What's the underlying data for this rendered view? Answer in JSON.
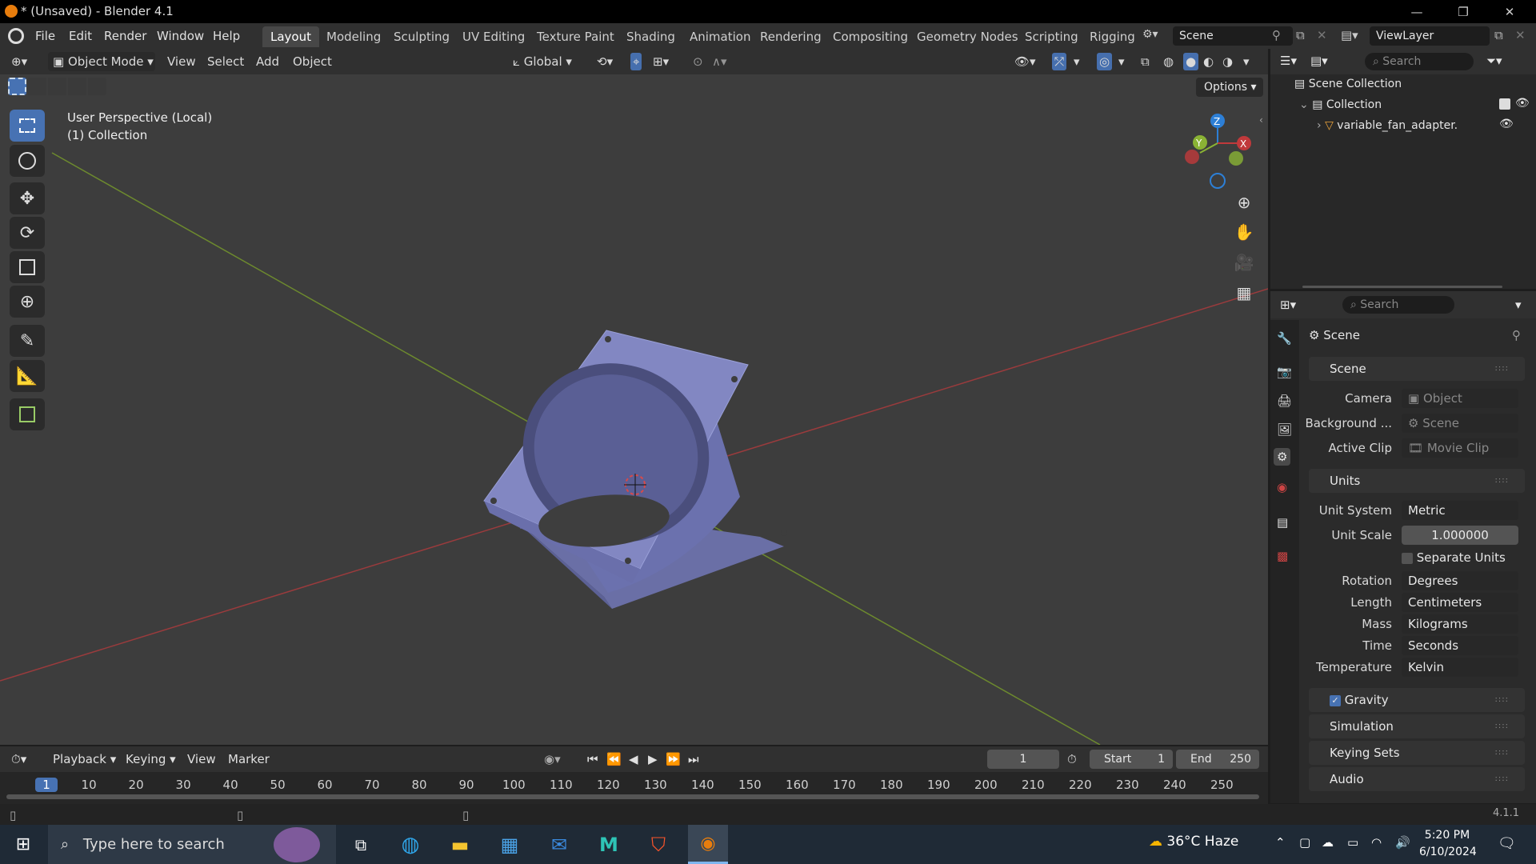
{
  "window": {
    "title": "* (Unsaved) - Blender 4.1",
    "minimize": "—",
    "maximize": "❐",
    "close": "✕"
  },
  "menu": [
    "File",
    "Edit",
    "Render",
    "Window",
    "Help"
  ],
  "workspaces": [
    "Layout",
    "Modeling",
    "Sculpting",
    "UV Editing",
    "Texture Paint",
    "Shading",
    "Animation",
    "Rendering",
    "Compositing",
    "Geometry Nodes",
    "Scripting",
    "Rigging"
  ],
  "active_workspace": "Layout",
  "scene_field": "Scene",
  "viewlayer_field": "ViewLayer",
  "viewport_header": {
    "mode": "Object Mode",
    "view": "View",
    "select": "Select",
    "add": "Add",
    "object": "Object",
    "transform": "Global",
    "options": "Options"
  },
  "viewport_overlay": {
    "line1": "User Perspective (Local)",
    "line2": "(1) Collection"
  },
  "gizmo": {
    "z": "Z",
    "y": "Y",
    "x": "X"
  },
  "outliner": {
    "search_placeholder": "Search",
    "scene_collection": "Scene Collection",
    "collection": "Collection",
    "object": "variable_fan_adapter."
  },
  "properties": {
    "search_placeholder": "Search",
    "context": "Scene",
    "scene_panel": "Scene",
    "camera_label": "Camera",
    "camera_value": "Object",
    "background_label": "Background ...",
    "background_value": "Scene",
    "clip_label": "Active Clip",
    "clip_value": "Movie Clip",
    "units_panel": "Units",
    "unit_system_label": "Unit System",
    "unit_system": "Metric",
    "unit_scale_label": "Unit Scale",
    "unit_scale": "1.000000",
    "separate_units": "Separate Units",
    "rotation_label": "Rotation",
    "rotation": "Degrees",
    "length_label": "Length",
    "length": "Centimeters",
    "mass_label": "Mass",
    "mass": "Kilograms",
    "time_label": "Time",
    "time": "Seconds",
    "temperature_label": "Temperature",
    "temperature": "Kelvin",
    "gravity": "Gravity",
    "simulation": "Simulation",
    "keying_sets": "Keying Sets",
    "audio": "Audio"
  },
  "timeline": {
    "playback": "Playback",
    "keying": "Keying",
    "view": "View",
    "marker": "Marker",
    "current_frame": "1",
    "start_label": "Start",
    "start": "1",
    "end_label": "End",
    "end": "250",
    "ticks": [
      "1",
      "10",
      "20",
      "30",
      "40",
      "50",
      "60",
      "70",
      "80",
      "90",
      "100",
      "110",
      "120",
      "130",
      "140",
      "150",
      "160",
      "170",
      "180",
      "190",
      "200",
      "210",
      "220",
      "230",
      "240",
      "250"
    ]
  },
  "status": {
    "version": "4.1.1"
  },
  "taskbar": {
    "search_placeholder": "Type here to search",
    "weather": "36°C Haze",
    "time": "5:20 PM",
    "date": "6/10/2024"
  },
  "colors": {
    "accent": "#4772b3",
    "model": "#7b80b8",
    "x_axis": "#c0393b",
    "y_axis": "#8ab334",
    "z_axis": "#2d7fd6"
  }
}
